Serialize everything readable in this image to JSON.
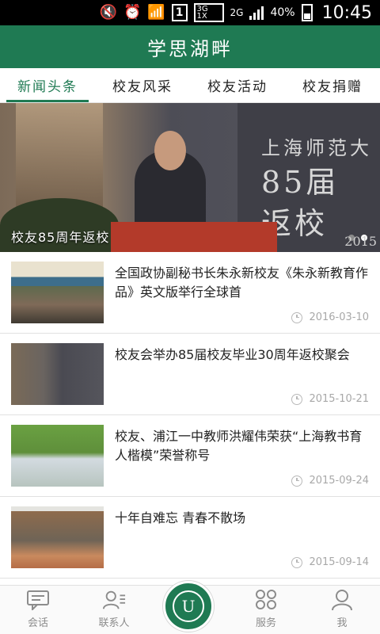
{
  "status_bar": {
    "sim_badge": "1",
    "network_top": "3G",
    "network_bottom": "1X",
    "network_2g": "2G",
    "battery_percent": "40%",
    "time": "10:45"
  },
  "header": {
    "title": "学思湖畔"
  },
  "tabs": [
    {
      "label": "新闻头条",
      "active": true
    },
    {
      "label": "校友风采",
      "active": false
    },
    {
      "label": "校友活动",
      "active": false
    },
    {
      "label": "校友捐赠",
      "active": false
    }
  ],
  "banner": {
    "caption": "校友85周年返校",
    "backdrop_text_line1": "上海师范大",
    "backdrop_text_line2": "85届",
    "backdrop_text_line3": "返校",
    "backdrop_year": "2015",
    "slide_count": 2,
    "active_slide": 1
  },
  "news": [
    {
      "title": "全国政协副秘书长朱永新校友《朱永新教育作品》英文版举行全球首",
      "date": "2016-03-10"
    },
    {
      "title": " 校友会举办85届校友毕业30周年返校聚会",
      "date": "2015-10-21"
    },
    {
      "title": "校友、浦江一中教师洪耀伟荣获“上海教书育人楷模”荣誉称号",
      "date": "2015-09-24"
    },
    {
      "title": "十年自难忘 青春不散场",
      "date": "2015-09-14"
    }
  ],
  "bottom_nav": {
    "items": [
      {
        "label": "会话",
        "icon": "chat-icon"
      },
      {
        "label": "联系人",
        "icon": "contacts-icon"
      },
      {
        "label": "",
        "icon": "university-logo"
      },
      {
        "label": "服务",
        "icon": "services-icon"
      },
      {
        "label": "我",
        "icon": "profile-icon"
      }
    ]
  },
  "colors": {
    "brand_green": "#1f7a53",
    "active_tab": "#1f7a53",
    "date_text": "#a8a8a8"
  }
}
